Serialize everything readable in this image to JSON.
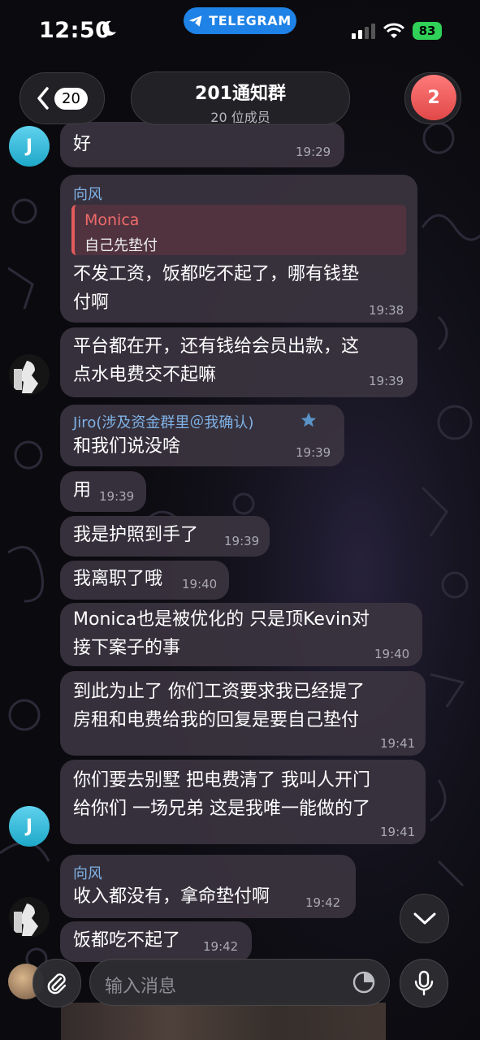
{
  "status_bar": {
    "time": "12:50",
    "app_pill": "TELEGRAM",
    "battery": "83"
  },
  "header": {
    "back_count": "20",
    "chat_title": "201通知群",
    "members": "20 位成员",
    "badge": "2"
  },
  "messages": [
    {
      "text_lines": [
        "好"
      ],
      "time": "19:29"
    },
    {
      "sender": "向风",
      "quote_name": "Monica",
      "quote_text": "自己先垫付",
      "text_lines": [
        "不发工资，饭都吃不起了，哪有钱垫",
        "付啊"
      ],
      "time": "19:38"
    },
    {
      "text_lines": [
        "平台都在开，还有钱给会员出款，这",
        "点水电费交不起嘛"
      ],
      "time": "19:39"
    },
    {
      "sender": "Jiro(涉及资金群里＠我确认)",
      "text_lines": [
        "和我们说没啥"
      ],
      "time": "19:39"
    },
    {
      "text_lines": [
        "用"
      ],
      "time": "19:39"
    },
    {
      "text_lines": [
        "我是护照到手了"
      ],
      "time": "19:39"
    },
    {
      "text_lines": [
        "我离职了哦"
      ],
      "time": "19:40"
    },
    {
      "text_lines": [
        "Monica也是被优化的 只是顶Kevin对",
        "接下案子的事"
      ],
      "time": "19:40"
    },
    {
      "text_lines": [
        "到此为止了 你们工资要求我已经提了",
        "房租和电费给我的回复是要自己垫付"
      ],
      "time": "19:41"
    },
    {
      "text_lines": [
        "你们要去别墅 把电费清了 我叫人开门",
        "给你们 一场兄弟 这是我唯一能做的了"
      ],
      "time": "19:41"
    },
    {
      "sender": "向风",
      "text_lines": [
        "收入都没有，拿命垫付啊"
      ],
      "time": "19:42"
    },
    {
      "text_lines": [
        "饭都吃不起了"
      ],
      "time": "19:42"
    }
  ],
  "avatars": {
    "jiro_initial": "J"
  },
  "input": {
    "placeholder": "输入消息"
  },
  "icons": [
    "back-chevron-icon",
    "telegram-plane-icon",
    "moon-icon",
    "signal-icon",
    "wifi-icon",
    "battery-icon",
    "attach-icon",
    "sticker-icon",
    "mic-icon",
    "chevron-down-icon"
  ]
}
